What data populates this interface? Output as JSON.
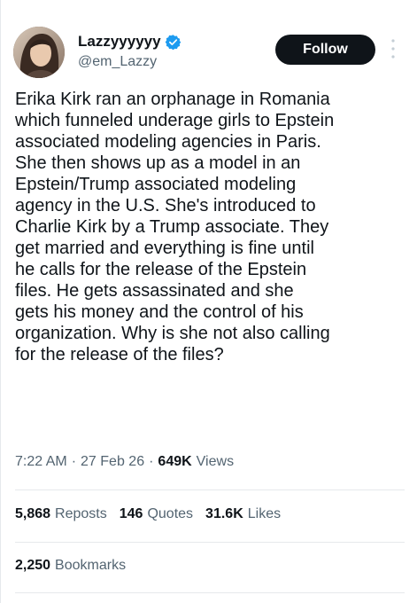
{
  "author": {
    "display_name": "Lazzyyyyyy",
    "handle": "@em_Lazzy",
    "verified_icon": "verified-badge-icon",
    "verified_color": "#1d9bf0"
  },
  "follow_label": "Follow",
  "tweet": {
    "text": "Erika Kirk ran an orphanage in Romania\nwhich funneled underage girls to Epstein\nassociated modeling agencies in Paris.\nShe then shows up as a model in an\nEpstein/Trump associated modeling\nagency in the U.S. She's introduced to\nCharlie Kirk by a Trump associate. They\nget married and everything is fine until\nhe calls for the release of the Epstein\nfiles. He gets assassinated and she\ngets his money and the control of his\norganization. Why is she not also calling\nfor the release of the files?"
  },
  "meta": {
    "time": "7:22 AM",
    "date": "27 Feb 26",
    "views_count": "649K",
    "views_label": "Views",
    "separator": "·"
  },
  "stats": {
    "reposts_count": "5,868",
    "reposts_label": "Reposts",
    "quotes_count": "146",
    "quotes_label": "Quotes",
    "likes_count": "31.6K",
    "likes_label": "Likes"
  },
  "bookmarks": {
    "count": "2,250",
    "label": "Bookmarks"
  },
  "colors": {
    "text_primary": "#0f1419",
    "text_secondary": "#536471",
    "divider": "#e6e9ec",
    "button_bg": "#0f1419"
  }
}
